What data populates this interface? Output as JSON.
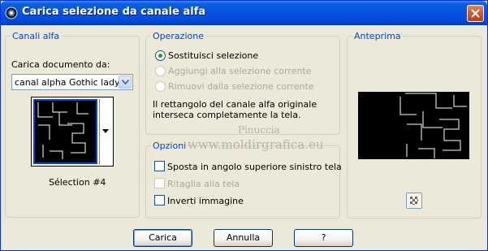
{
  "window": {
    "title": "Carica selezione da canale alfa",
    "close_icon": "close-icon"
  },
  "canali_alfa": {
    "legend": "Canali alfa",
    "doc_label": "Carica documento da:",
    "doc_value": "canal alpha Gothic lady",
    "selection_label": "Sélection #4"
  },
  "operazione": {
    "legend": "Operazione",
    "options": [
      {
        "label": "Sostituisci selezione",
        "checked": true,
        "enabled": true
      },
      {
        "label": "Aggiungi alla selezione corrente",
        "checked": false,
        "enabled": false
      },
      {
        "label": "Rimuovi dalla selezione corrente",
        "checked": false,
        "enabled": false
      }
    ],
    "info_line1": "Il rettangolo del canale alfa originale",
    "info_line2": "interseca completamente la tela."
  },
  "opzioni": {
    "legend": "Opzioni",
    "options": [
      {
        "label": "Sposta in angolo superiore sinistro tela",
        "checked": false,
        "enabled": true
      },
      {
        "label": "Ritaglia alla tela",
        "checked": false,
        "enabled": false
      },
      {
        "label": "Inverti immagine",
        "checked": false,
        "enabled": true
      }
    ]
  },
  "anteprima": {
    "legend": "Anteprima",
    "zoom_icon": "checker-icon"
  },
  "watermark": {
    "line1": "Pinuccia",
    "line2": "www.moldirgrafica.eu"
  },
  "buttons": {
    "ok": "Carica",
    "cancel": "Annulla",
    "help": "?"
  }
}
